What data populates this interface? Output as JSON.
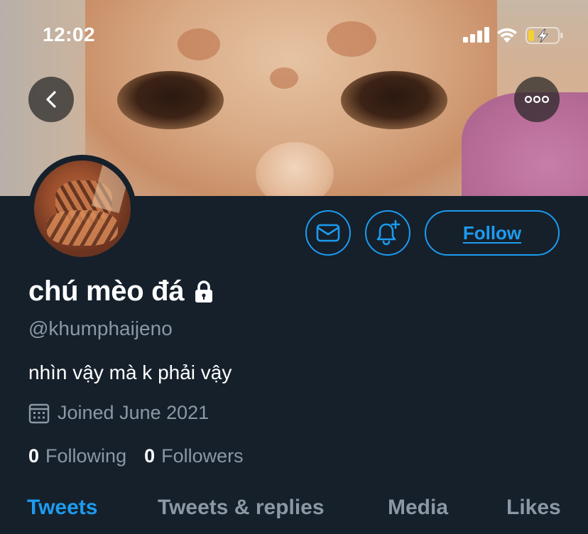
{
  "status_bar": {
    "time": "12:02"
  },
  "profile": {
    "display_name": "chú mèo đá",
    "handle": "@khumphaijeno",
    "bio": "nhìn vậy mà k phải vậy",
    "joined": "Joined June 2021",
    "following_count": "0",
    "following_label": "Following",
    "followers_count": "0",
    "followers_label": "Followers",
    "protected": true
  },
  "actions": {
    "follow_label": "Follow"
  },
  "tabs": [
    {
      "label": "Tweets",
      "active": true
    },
    {
      "label": "Tweets & replies",
      "active": false
    },
    {
      "label": "Media",
      "active": false
    },
    {
      "label": "Likes",
      "active": false
    }
  ],
  "colors": {
    "background": "#15202b",
    "accent": "#1d9bf0",
    "secondary_text": "#8b98a5",
    "battery_charging": "#f5d033"
  },
  "icons": [
    "back-arrow-icon",
    "more-options-icon",
    "message-icon",
    "notification-bell-plus-icon",
    "lock-icon",
    "calendar-icon",
    "signal-icon",
    "wifi-icon",
    "battery-charging-icon"
  ]
}
